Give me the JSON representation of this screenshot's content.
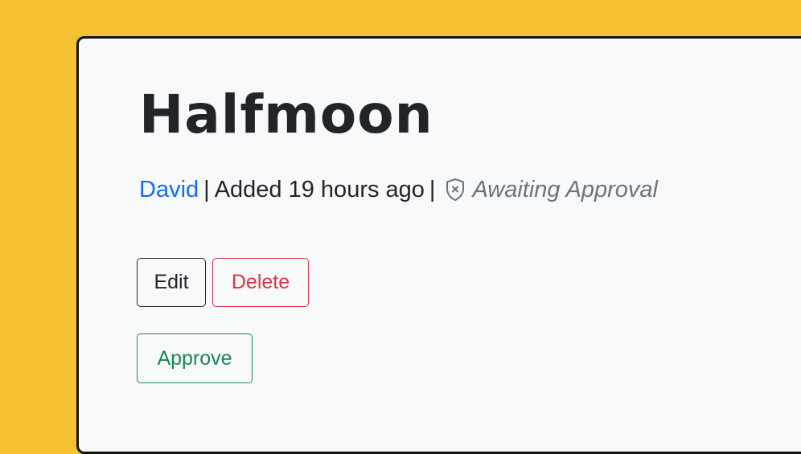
{
  "post": {
    "title": "Halfmoon",
    "author": "David",
    "separator": "|",
    "added": "Added 19 hours ago",
    "status": "Awaiting Approval",
    "status_icon": "shield-x-icon"
  },
  "actions": {
    "edit_label": "Edit",
    "delete_label": "Delete",
    "approve_label": "Approve"
  },
  "colors": {
    "background": "#f4c133",
    "card": "#f8f9fa",
    "link": "#0d6efd",
    "danger": "#dc3545",
    "success": "#198754",
    "muted": "#6c757d"
  }
}
